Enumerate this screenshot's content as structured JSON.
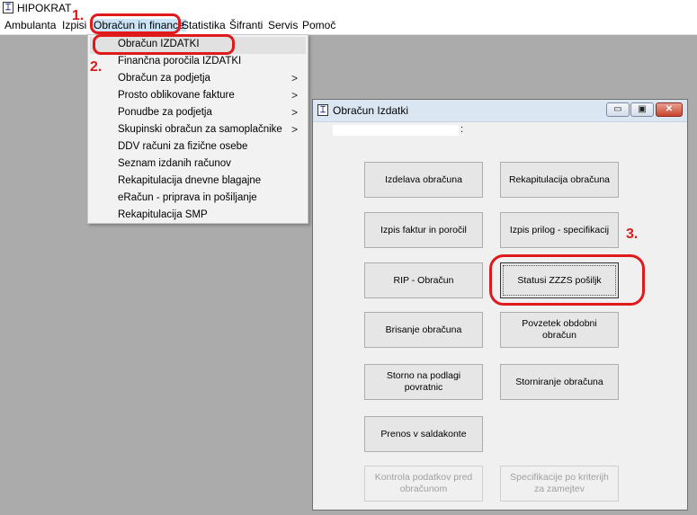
{
  "app": {
    "title": "HIPOKRAT",
    "icon": "hipokrat-app-icon"
  },
  "menubar": {
    "items": [
      {
        "label": "Ambulanta"
      },
      {
        "label": "Izpisi"
      },
      {
        "label": "Obračun in finance"
      },
      {
        "label": "Statistika"
      },
      {
        "label": "Šifranti"
      },
      {
        "label": "Servis"
      },
      {
        "label": "Pomoč"
      }
    ]
  },
  "dropdown": {
    "items": [
      {
        "label": "Obračun IZDATKI",
        "submenu": false
      },
      {
        "label": "Finančna poročila IZDATKI",
        "submenu": false
      },
      {
        "label": "Obračun za podjetja",
        "submenu": true
      },
      {
        "label": "Prosto oblikovane fakture",
        "submenu": true
      },
      {
        "label": "Ponudbe za podjetja",
        "submenu": true
      },
      {
        "label": "Skupinski obračun za samoplačnike",
        "submenu": true
      },
      {
        "label": "DDV računi za fizične osebe",
        "submenu": false
      },
      {
        "label": "Seznam izdanih računov",
        "submenu": false
      },
      {
        "label": "Rekapitulacija dnevne blagajne",
        "submenu": false
      },
      {
        "label": "eRačun - priprava in pošiljanje",
        "submenu": false
      },
      {
        "label": "Rekapitulacija SMP",
        "submenu": false
      }
    ],
    "submenu_arrow": ">"
  },
  "dialog": {
    "title": "Obračun Izdatki",
    "controls": {
      "minimize": "▭",
      "maximize": "▣",
      "close": "✕"
    },
    "header_colon": ":",
    "buttons": [
      {
        "label": "Izdelava obračuna",
        "enabled": true
      },
      {
        "label": "Rekapitulacija obračuna",
        "enabled": true
      },
      {
        "label": "Izpis faktur in poročil",
        "enabled": true
      },
      {
        "label": "Izpis prilog - specifikacij",
        "enabled": true
      },
      {
        "label": "RIP - Obračun",
        "enabled": true
      },
      {
        "label": "Statusi ZZZS pošiljk",
        "enabled": true
      },
      {
        "label": "Brisanje obračuna",
        "enabled": true
      },
      {
        "label": "Povzetek obdobni obračun",
        "enabled": true
      },
      {
        "label": "Storno na podlagi povratnic",
        "enabled": true
      },
      {
        "label": "Storniranje obračuna",
        "enabled": true
      },
      {
        "label": "Prenos v saldakonte",
        "enabled": true
      },
      {
        "label": "Kontrola podatkov pred obračunom",
        "enabled": false
      },
      {
        "label": "Specifikacije po kriterijh za zamejtev",
        "enabled": false
      }
    ]
  },
  "annotations": {
    "steps": [
      "1.",
      "2.",
      "3."
    ],
    "color": "#e01a1a"
  }
}
